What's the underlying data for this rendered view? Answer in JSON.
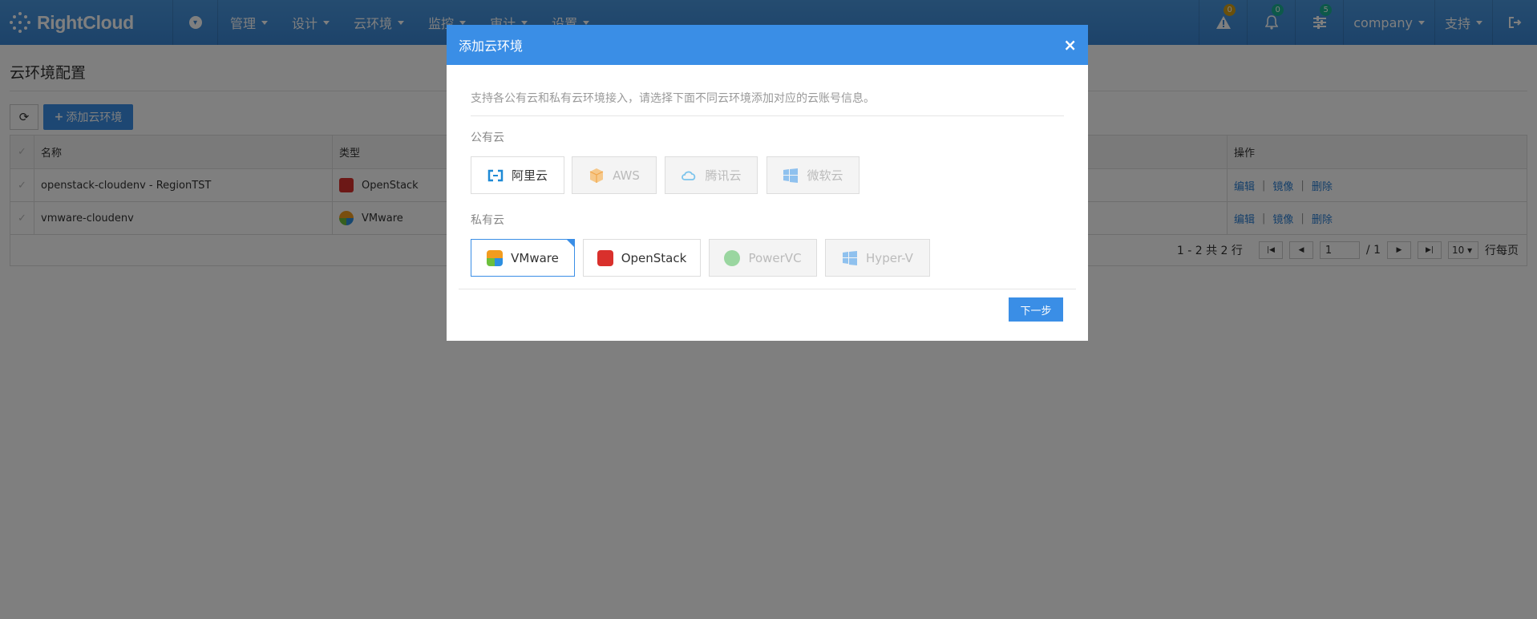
{
  "nav": {
    "brand": "RightCloud",
    "menu": [
      "管理",
      "设计",
      "云环境",
      "监控",
      "审计",
      "设置"
    ],
    "alerts_count": "0",
    "notifications_count": "0",
    "tasks_count": "5",
    "user": "company",
    "support": "支持"
  },
  "page": {
    "title": "云环境配置",
    "add_button": "添加云环境",
    "columns": {
      "name": "名称",
      "type": "类型",
      "ops": "操作"
    },
    "rows": [
      {
        "name": "openstack-cloudenv - RegionTST",
        "type": "OpenStack"
      },
      {
        "name": "vmware-cloudenv",
        "type": "VMware"
      }
    ],
    "ops": {
      "edit": "编辑",
      "image": "镜像",
      "delete": "删除"
    },
    "pager": {
      "summary": "1 - 2 共 2 行",
      "page": "1",
      "total": "/ 1",
      "page_size": "10 ▾",
      "per_page_label": "行每页"
    }
  },
  "modal": {
    "title": "添加云环境",
    "close": "×",
    "description": "支持各公有云和私有云环境接入，请选择下面不同云环境添加对应的云账号信息。",
    "public_label": "公有云",
    "public": [
      {
        "label": "阿里云",
        "enabled": true
      },
      {
        "label": "AWS",
        "enabled": false
      },
      {
        "label": "腾讯云",
        "enabled": false
      },
      {
        "label": "微软云",
        "enabled": false
      }
    ],
    "private_label": "私有云",
    "private": [
      {
        "label": "VMware",
        "enabled": true,
        "selected": true
      },
      {
        "label": "OpenStack",
        "enabled": true
      },
      {
        "label": "PowerVC",
        "enabled": false
      },
      {
        "label": "Hyper-V",
        "enabled": false
      }
    ],
    "next_button": "下一步"
  },
  "colors": {
    "accent": "#3a8ee6",
    "overlay": "rgba(0,0,0,0.5)",
    "openstack_red": "#d9302c",
    "aliyun_blue": "#1f8ad6"
  }
}
